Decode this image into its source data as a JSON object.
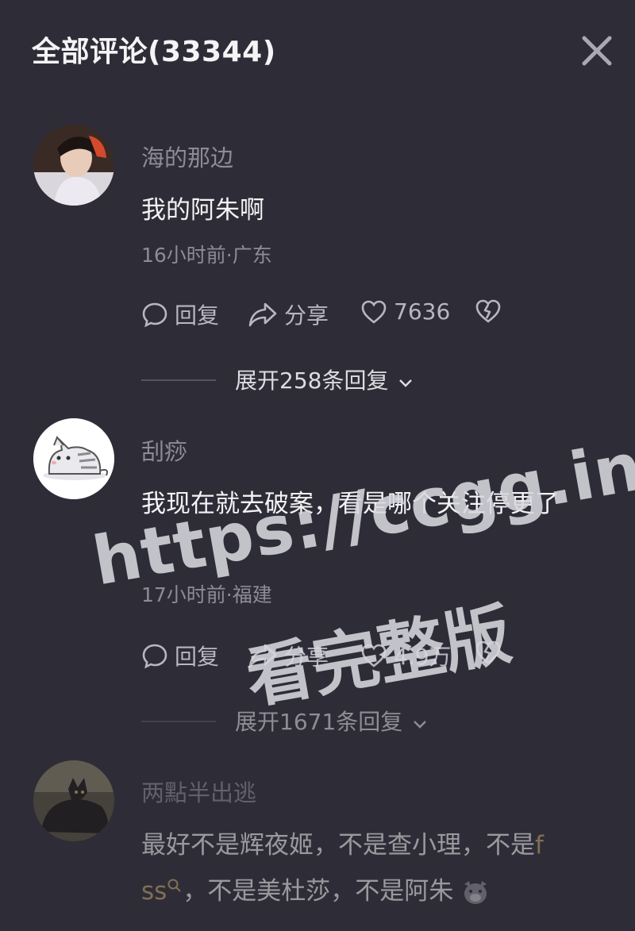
{
  "header": {
    "title": "全部评论(33344)",
    "close_icon": "close-icon"
  },
  "comments": [
    {
      "username": "海的那边",
      "text": "我的阿朱啊",
      "meta": "16小时前·广东",
      "reply_label": "回复",
      "share_label": "分享",
      "likes": "7636",
      "expand_label": "展开258条回复"
    },
    {
      "username": "刮痧",
      "text": "我现在就去破案，看是哪个关注停更了",
      "meta": "17小时前·福建",
      "reply_label": "回复",
      "share_label": "分享",
      "likes": "4.9万",
      "expand_label": "展开1671条回复"
    },
    {
      "username": "两點半出逃",
      "text_part1": "最好不是辉夜姬，不是查小理，不是",
      "text_tag_a": "f",
      "text_tag_b": "ss",
      "text_part2": "，不是美杜莎，不是阿朱"
    }
  ],
  "watermark": {
    "line1": "https://ccgg.ink",
    "line2": "看完整版"
  },
  "colors": {
    "background": "#2e2d37",
    "secondary_text": "#8d8b98",
    "primary_text": "#f3f3f5",
    "tag": "#c7a76b"
  }
}
